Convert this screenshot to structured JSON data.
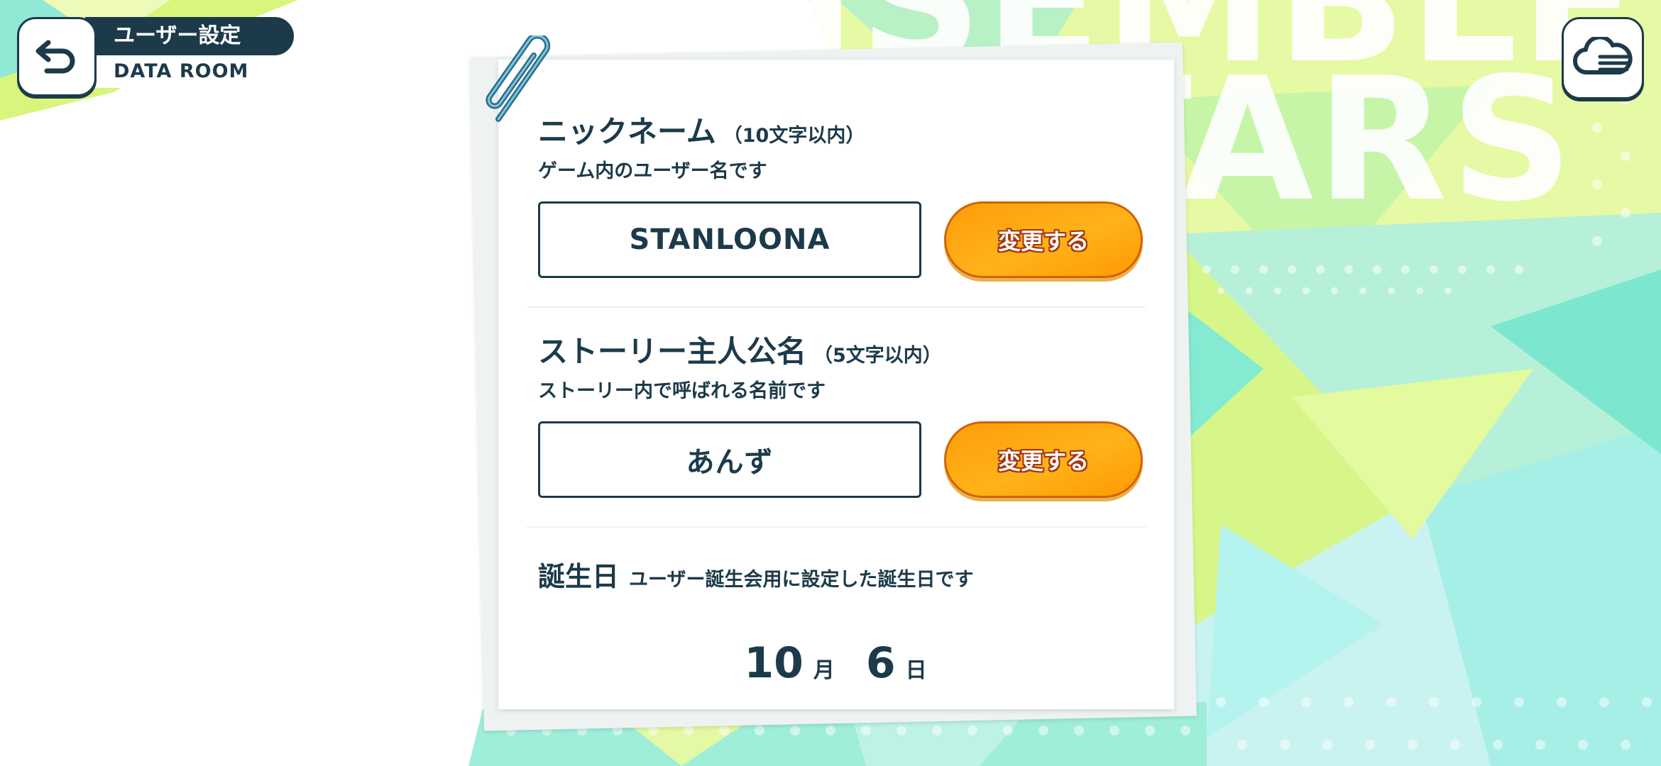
{
  "header": {
    "title": "ユーザー設定",
    "subtitle": "DATA ROOM",
    "back_icon": "back-arrow-icon",
    "cloud_icon": "cloud-menu-icon"
  },
  "background": {
    "title_line1": "ENSEMBLE",
    "title_line2": "STARS",
    "colors": [
      "#d8f37a",
      "#a8f0e2",
      "#6fe8c9",
      "#e9fba0"
    ]
  },
  "nickname": {
    "title": "ニックネーム",
    "limit": "（10文字以内）",
    "description": "ゲーム内のユーザー名です",
    "value": "STANLOONA",
    "button_label": "変更する"
  },
  "story_name": {
    "title": "ストーリー主人公名",
    "limit": "（5文字以内）",
    "description": "ストーリー内で呼ばれる名前です",
    "value": "あんず",
    "button_label": "変更する"
  },
  "birthday": {
    "title": "誕生日",
    "description": "ユーザー誕生会用に設定した誕生日です",
    "month": "10",
    "month_unit": "月",
    "day": "6",
    "day_unit": "日"
  },
  "accent_colors": {
    "navy": "#1c3a4a",
    "orange": "#ff9d0a"
  }
}
